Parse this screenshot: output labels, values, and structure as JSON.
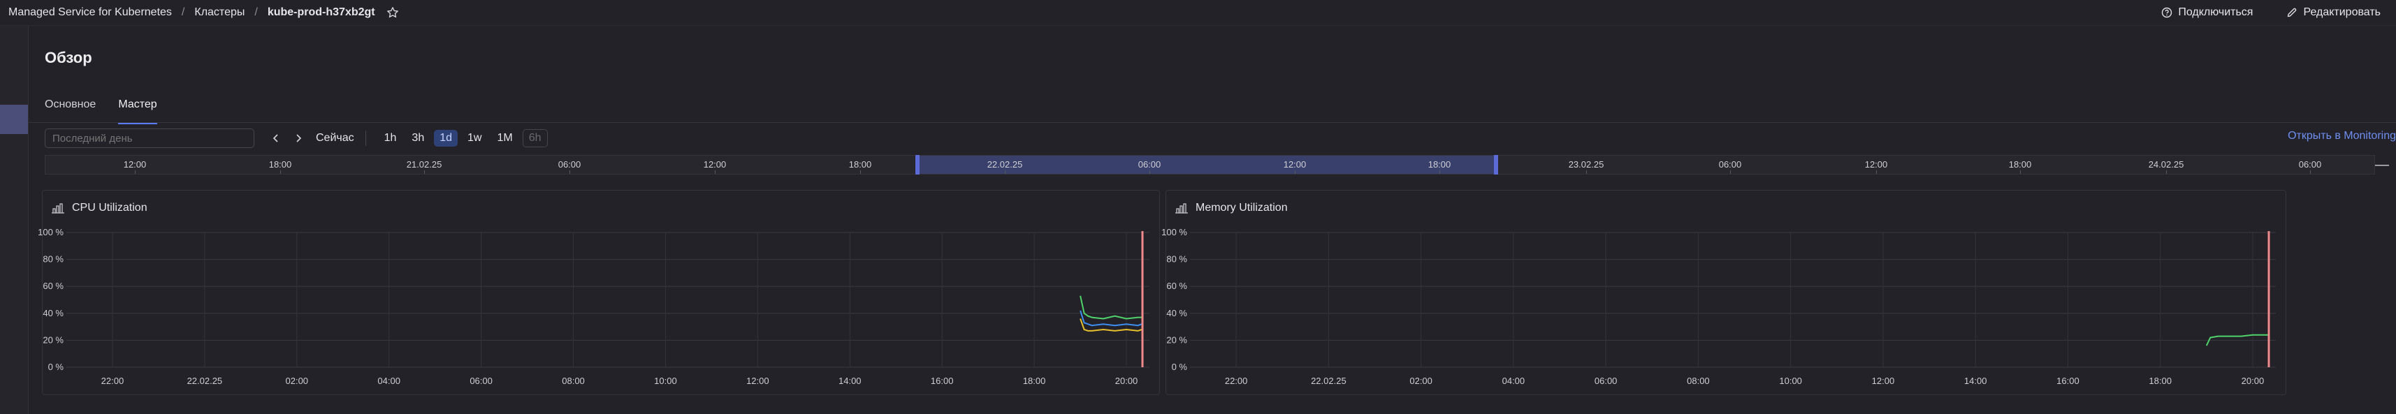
{
  "header": {
    "breadcrumbs": [
      {
        "label": "Managed Service for Kubernetes"
      },
      {
        "label": "Кластеры"
      },
      {
        "label": "kube-prod-h37xb2gt"
      }
    ],
    "actions": {
      "connect": "Подключиться",
      "edit": "Редактировать"
    }
  },
  "page": {
    "title": "Обзор"
  },
  "tabs": [
    {
      "label": "Основное"
    },
    {
      "label": "Мастер",
      "active": true
    }
  ],
  "toolbar": {
    "range_placeholder": "Последний день",
    "now": "Сейчас",
    "scales": [
      "1h",
      "3h",
      "1d",
      "1w",
      "1M",
      "6h"
    ],
    "active_scale": "1d",
    "disabled_scale": "6h",
    "open_monitoring": "Открыть в Monitoring"
  },
  "timeline": {
    "labels": [
      "12:00",
      "18:00",
      "21.02.25",
      "06:00",
      "12:00",
      "18:00",
      "22.02.25",
      "06:00",
      "12:00",
      "18:00",
      "23.02.25",
      "06:00",
      "12:00",
      "18:00",
      "24.02.25",
      "06:00"
    ]
  },
  "colors": {
    "accent": "#5b7cf7",
    "link": "#6f8ff1",
    "selection": "#39406c",
    "now_line": "#f08a8a"
  },
  "charts": [
    {
      "title": "CPU Utilization",
      "icon": "chart-icon",
      "chart_data": {
        "type": "line",
        "yticks": [
          "100 %",
          "80 %",
          "60 %",
          "40 %",
          "20 %",
          "0 %"
        ],
        "xticks": [
          "22:00",
          "22.02.25",
          "02:00",
          "04:00",
          "06:00",
          "08:00",
          "10:00",
          "12:00",
          "14:00",
          "16:00",
          "18:00",
          "20:00"
        ],
        "ylim": [
          0,
          100
        ],
        "series": [
          {
            "color": "#4fd36a",
            "x": [
              "19:00",
              "19:05",
              "19:10",
              "19:15",
              "19:30",
              "19:45",
              "20:00",
              "20:15",
              "20:20"
            ],
            "y": [
              53,
              40,
              38,
              37,
              36,
              38,
              36,
              37,
              37
            ]
          },
          {
            "color": "#3d8ef0",
            "x": [
              "19:00",
              "19:05",
              "19:10",
              "19:15",
              "19:30",
              "19:45",
              "20:00",
              "20:15",
              "20:20"
            ],
            "y": [
              42,
              33,
              32,
              31,
              32,
              31,
              32,
              31,
              32
            ]
          },
          {
            "color": "#e8c02e",
            "x": [
              "19:00",
              "19:05",
              "19:10",
              "19:15",
              "19:30",
              "19:45",
              "20:00",
              "20:15",
              "20:20"
            ],
            "y": [
              36,
              28,
              27,
              27,
              28,
              27,
              28,
              27,
              28
            ]
          }
        ]
      }
    },
    {
      "title": "Memory Utilization",
      "icon": "chart-icon",
      "chart_data": {
        "type": "line",
        "yticks": [
          "100 %",
          "80 %",
          "60 %",
          "40 %",
          "20 %",
          "0 %"
        ],
        "xticks": [
          "22:00",
          "22.02.25",
          "02:00",
          "04:00",
          "06:00",
          "08:00",
          "10:00",
          "12:00",
          "14:00",
          "16:00",
          "18:00",
          "20:00"
        ],
        "ylim": [
          0,
          100
        ],
        "series": [
          {
            "color": "#4fd36a",
            "x": [
              "19:00",
              "19:05",
              "19:15",
              "19:30",
              "19:45",
              "20:00",
              "20:15",
              "20:20"
            ],
            "y": [
              16,
              22,
              23,
              23,
              23,
              24,
              24,
              24
            ]
          }
        ]
      }
    }
  ]
}
